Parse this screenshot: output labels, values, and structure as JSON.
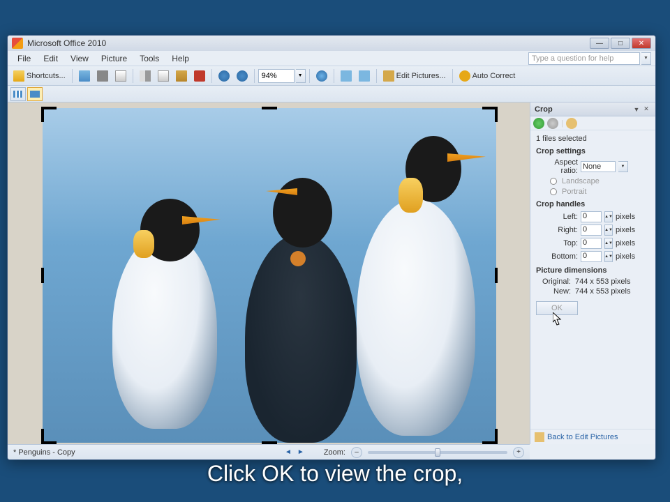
{
  "app": {
    "title": "Microsoft Office 2010"
  },
  "menu": {
    "file": "File",
    "edit": "Edit",
    "view": "View",
    "picture": "Picture",
    "tools": "Tools",
    "help": "Help",
    "helpbox_placeholder": "Type a question for help"
  },
  "toolbar": {
    "shortcuts": "Shortcuts...",
    "zoom": "94%",
    "edit_pictures": "Edit Pictures...",
    "auto_correct": "Auto Correct"
  },
  "sidepane": {
    "title": "Crop",
    "files_selected": "1 files selected",
    "crop_settings_h": "Crop settings",
    "aspect_ratio_lbl": "Aspect ratio:",
    "aspect_ratio_val": "None",
    "landscape": "Landscape",
    "portrait": "Portrait",
    "crop_handles_h": "Crop handles",
    "left_lbl": "Left:",
    "left_val": "0",
    "right_lbl": "Right:",
    "right_val": "0",
    "top_lbl": "Top:",
    "top_val": "0",
    "bottom_lbl": "Bottom:",
    "bottom_val": "0",
    "unit": "pixels",
    "pic_dims_h": "Picture dimensions",
    "orig_lbl": "Original:",
    "orig_val": "744 x 553 pixels",
    "new_lbl": "New:",
    "new_val": "744 x 553 pixels",
    "ok": "OK",
    "back_link": "Back to Edit Pictures"
  },
  "status": {
    "filename": "* Penguins - Copy",
    "zoom_lbl": "Zoom:"
  },
  "caption": "Click OK to view the crop,"
}
